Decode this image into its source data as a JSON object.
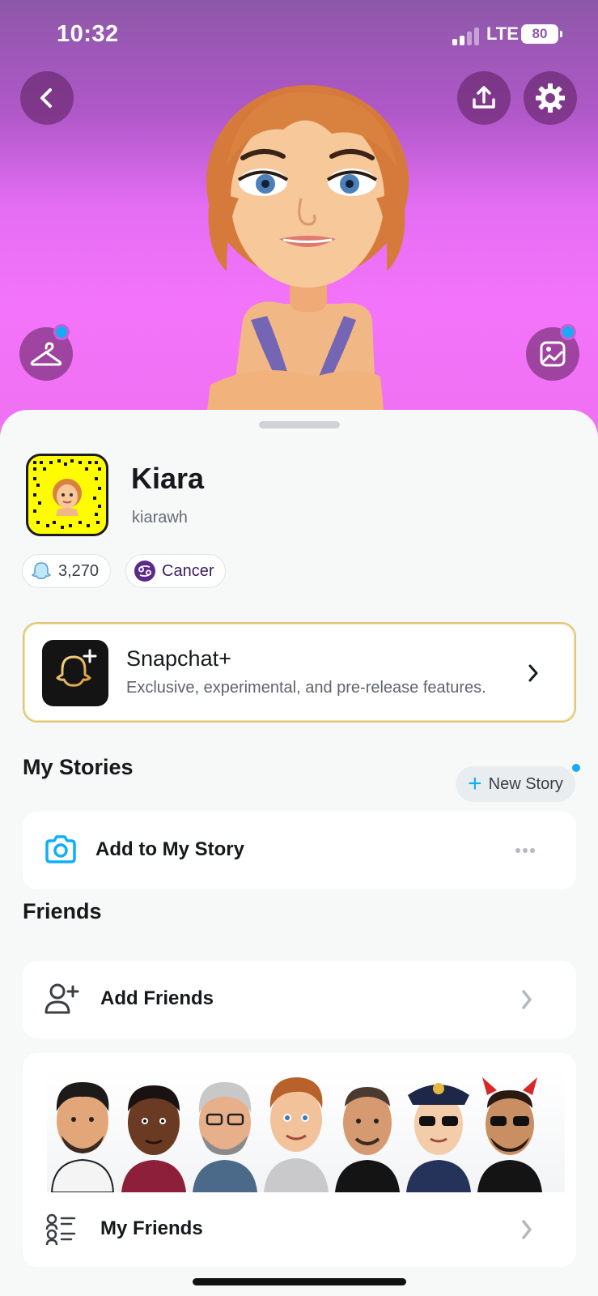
{
  "status_bar": {
    "time": "10:32",
    "network": "LTE",
    "battery": "80"
  },
  "header": {
    "back_icon": "chevron-left-icon",
    "share_icon": "share-upload-icon",
    "settings_icon": "gear-icon",
    "outfit_icon": "hanger-icon",
    "background_icon": "image-icon",
    "bg_color_top": "#8d58a8",
    "bg_color_bottom": "#f374fa"
  },
  "profile": {
    "display_name": "Kiara",
    "username": "kiarawh",
    "snap_score": "3,270",
    "zodiac": "Cancer"
  },
  "snapchat_plus": {
    "title": "Snapchat+",
    "subtitle": "Exclusive, experimental, and pre-release features."
  },
  "my_stories": {
    "title": "My Stories",
    "new_story_label": "New Story",
    "add_to_story_label": "Add to My Story"
  },
  "friends": {
    "title": "Friends",
    "add_friends_label": "Add Friends",
    "my_friends_label": "My Friends"
  },
  "colors": {
    "accent_blue": "#0fadff",
    "snap_yellow": "#fffc00",
    "gold_border": "#e1c67a",
    "zodiac_purple": "#5b2b8c"
  }
}
